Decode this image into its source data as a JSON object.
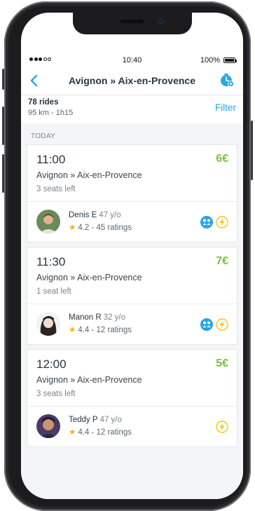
{
  "status_bar": {
    "time": "10:40",
    "battery": "100%"
  },
  "nav": {
    "title": "Avignon » Aix-en-Provence"
  },
  "summary": {
    "count": "78 rides",
    "meta": "95 km - 1h15",
    "filter_label": "Filter"
  },
  "section_label": "TODAY",
  "rides": [
    {
      "time": "11:00",
      "price": "6€",
      "route": "Avignon » Aix-en-Provence",
      "seats": "3 seats left",
      "driver": "Denis E",
      "age": "47 y/o",
      "rating": "4.2 - 45 ratings",
      "badges": [
        "ladies-only-icon",
        "instant-booking-icon"
      ]
    },
    {
      "time": "11:30",
      "price": "7€",
      "route": "Avignon » Aix-en-Provence",
      "seats": "1 seat left",
      "driver": "Manon R",
      "age": "32 y/o",
      "rating": "4.4 - 12 ratings",
      "badges": [
        "ladies-only-icon",
        "instant-booking-icon"
      ]
    },
    {
      "time": "12:00",
      "price": "5€",
      "route": "Avignon » Aix-en-Provence",
      "seats": "3 seats left",
      "driver": "Teddy P",
      "age": "47 y/o",
      "rating": "4.4 - 12 ratings",
      "badges": [
        "instant-booking-icon"
      ]
    }
  ],
  "colors": {
    "accent_blue": "#29a6df",
    "price_green": "#7cc142",
    "star_yellow": "#f5b301",
    "bolt_yellow": "#f5c518"
  }
}
